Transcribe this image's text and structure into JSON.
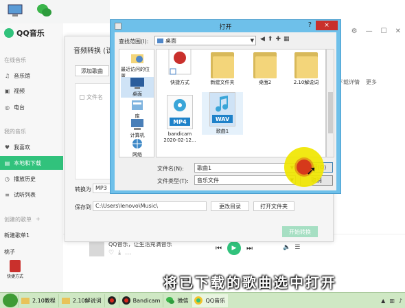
{
  "desktop_shortcut": {
    "label": "快捷方式"
  },
  "qq": {
    "app_name": "QQ音乐",
    "sections": {
      "online": "在线音乐",
      "my": "我的音乐",
      "create": "创建的歌单"
    },
    "online_items": [
      {
        "label": "音乐馆",
        "icon": "music-note-icon"
      },
      {
        "label": "视频",
        "icon": "video-icon"
      },
      {
        "label": "电台",
        "icon": "radio-icon"
      }
    ],
    "my_items": [
      {
        "label": "我喜欢",
        "icon": "heart-icon"
      },
      {
        "label": "本地和下载",
        "icon": "download-icon"
      },
      {
        "label": "播放历史",
        "icon": "history-icon"
      },
      {
        "label": "试听列表",
        "icon": "list-icon"
      }
    ],
    "playlists": [
      "新建歌单1",
      "桃子"
    ],
    "create_actions": [
      "+"
    ],
    "right_links": [
      "下载详情",
      "更多"
    ],
    "player": {
      "now_playing": "QQ音乐，让生活充满音乐",
      "controls": [
        "prev",
        "play",
        "next"
      ]
    }
  },
  "convert": {
    "title": "音频转换 (该",
    "add_song": "添加歌曲",
    "filename_col": "文件名",
    "convert_to_label": "转换为",
    "convert_to_value": "MP3",
    "save_to_label": "保存到",
    "save_to_value": "C:\\Users\\lenovo\\Music\\",
    "change_dir": "更改目录",
    "open_folder": "打开文件夹",
    "start": "开始转换"
  },
  "open_dialog": {
    "title": "打开",
    "help": "?",
    "close": "×",
    "look_in_label": "查找范围(I):",
    "look_in_value": "桌面",
    "places": [
      {
        "label": "最近访问的位置",
        "icon": "recent-places-icon"
      },
      {
        "label": "桌面",
        "icon": "desktop-icon",
        "selected": true
      },
      {
        "label": "库",
        "icon": "library-icon"
      },
      {
        "label": "计算机",
        "icon": "computer-icon"
      },
      {
        "label": "网络",
        "icon": "network-icon"
      }
    ],
    "files": [
      {
        "name": "快捷方式",
        "kind": "shortcut"
      },
      {
        "name": "新建文件夹",
        "kind": "folder"
      },
      {
        "name": "桌面2",
        "kind": "folder"
      },
      {
        "name": "2.10解说词",
        "kind": "folder"
      },
      {
        "name": "bandicam\n2020-02-12...",
        "kind": "video",
        "badge": "MP4"
      },
      {
        "name": "歌曲1",
        "kind": "audio",
        "badge": "WAV",
        "selected": true
      }
    ],
    "filename_label": "文件名(N):",
    "filename_value": "歌曲1",
    "filetype_label": "文件类型(T):",
    "filetype_value": "音乐文件",
    "open_button": "打开(O)",
    "cancel_button": "取消"
  },
  "subtitle": "将已下载的歌曲选中打开",
  "taskbar": {
    "items": [
      {
        "label": "2.10教程",
        "icon": "folder-icon"
      },
      {
        "label": "2.10解说词",
        "icon": "folder-icon"
      },
      {
        "label": "",
        "icon": "record-icon"
      },
      {
        "label": "Bandicam",
        "icon": "bandicam-icon"
      },
      {
        "label": "微信",
        "icon": "wechat-icon"
      },
      {
        "label": "QQ音乐",
        "icon": "qqmusic-icon",
        "active": true
      }
    ]
  },
  "colors": {
    "accent": "#31c27c",
    "dialog_frame": "#6ec0ea",
    "highlight": "#f0e600",
    "taskbar": "#cfe8c4"
  }
}
